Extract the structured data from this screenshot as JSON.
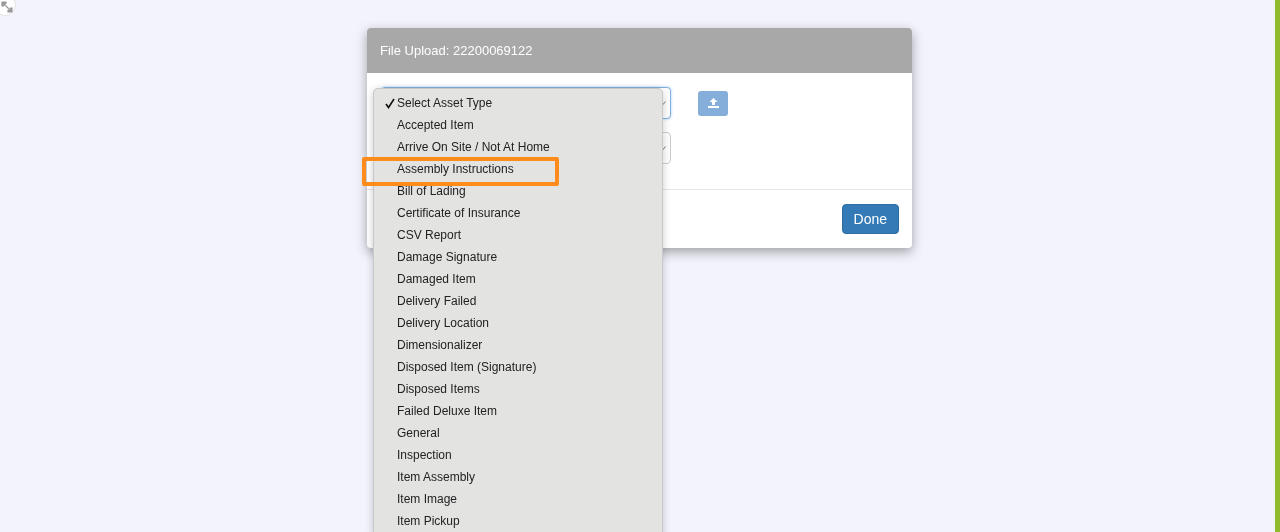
{
  "dialog": {
    "title": "File Upload: 22200069122",
    "fields": [
      {
        "kind": "select",
        "focused": true,
        "upload_button": true
      },
      {
        "kind": "select",
        "focused": false,
        "upload_button": false
      }
    ],
    "buttons": [
      {
        "label": "Done"
      }
    ]
  },
  "dropdown": {
    "items": [
      {
        "label": "Select Asset Type",
        "checked": true,
        "highlighted": false
      },
      {
        "label": "Accepted Item",
        "checked": false,
        "highlighted": false
      },
      {
        "label": "Arrive On Site / Not At Home",
        "checked": false,
        "highlighted": false
      },
      {
        "label": "Assembly Instructions",
        "checked": false,
        "highlighted": true
      },
      {
        "label": "Bill of Lading",
        "checked": false,
        "highlighted": false
      },
      {
        "label": "Certificate of Insurance",
        "checked": false,
        "highlighted": false
      },
      {
        "label": "CSV Report",
        "checked": false,
        "highlighted": false
      },
      {
        "label": "Damage Signature",
        "checked": false,
        "highlighted": false
      },
      {
        "label": "Damaged Item",
        "checked": false,
        "highlighted": false
      },
      {
        "label": "Delivery Failed",
        "checked": false,
        "highlighted": false
      },
      {
        "label": "Delivery Location",
        "checked": false,
        "highlighted": false
      },
      {
        "label": "Dimensionalizer",
        "checked": false,
        "highlighted": false
      },
      {
        "label": "Disposed Item (Signature)",
        "checked": false,
        "highlighted": false
      },
      {
        "label": "Disposed Items",
        "checked": false,
        "highlighted": false
      },
      {
        "label": "Failed Deluxe Item",
        "checked": false,
        "highlighted": false
      },
      {
        "label": "General",
        "checked": false,
        "highlighted": false
      },
      {
        "label": "Inspection",
        "checked": false,
        "highlighted": false
      },
      {
        "label": "Item Assembly",
        "checked": false,
        "highlighted": false
      },
      {
        "label": "Item Image",
        "checked": false,
        "highlighted": false
      },
      {
        "label": "Item Pickup",
        "checked": false,
        "highlighted": false
      }
    ]
  }
}
